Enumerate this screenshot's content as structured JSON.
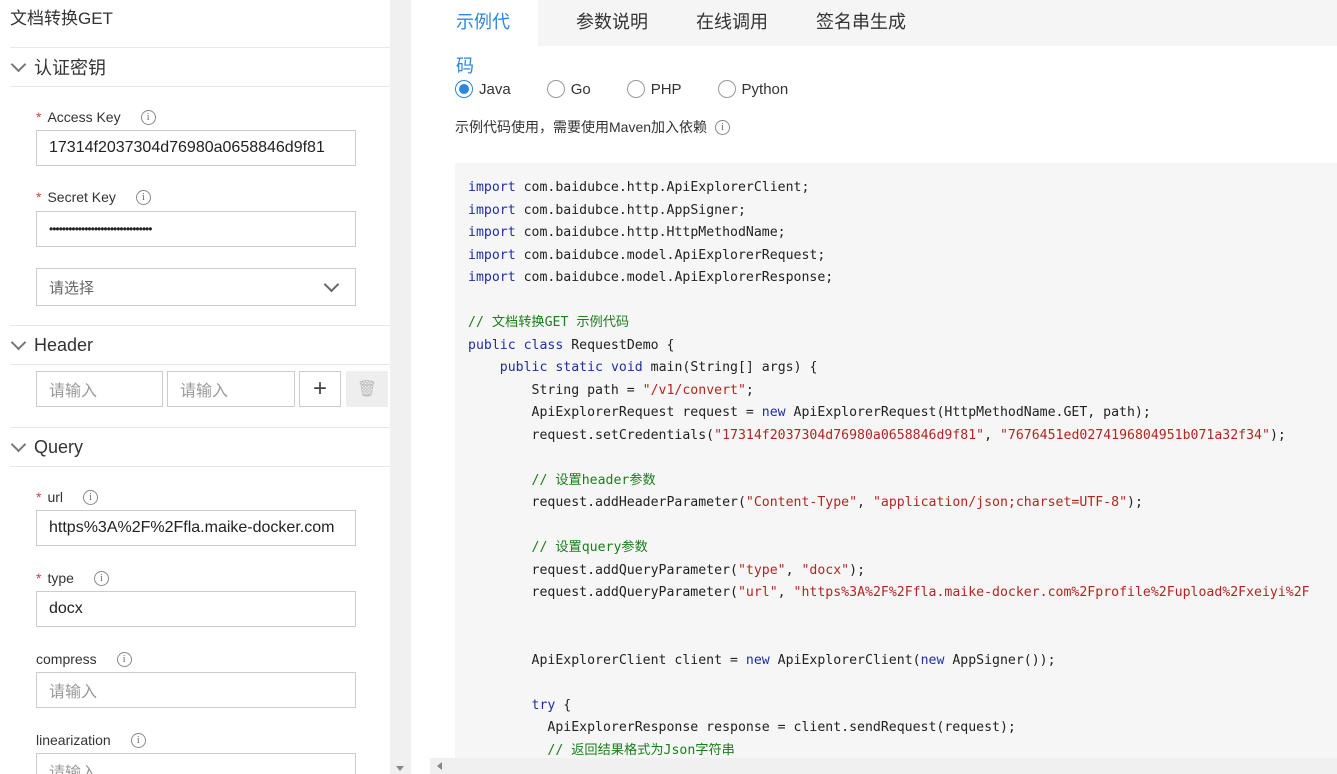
{
  "left": {
    "title": "文档转换GET",
    "auth_section": "认证密钥",
    "access_key_label": "Access Key",
    "access_key_value": "17314f2037304d76980a0658846d9f81",
    "secret_key_label": "Secret Key",
    "secret_key_value": "••••••••••••••••••••••••••••••••",
    "select_placeholder": "请选择",
    "header_section": "Header",
    "header_key_placeholder": "请输入",
    "header_value_placeholder": "请输入",
    "add_symbol": "+",
    "delete_symbol": "🗑",
    "query_section": "Query",
    "url_label": "url",
    "url_value": "https%3A%2F%2Ffla.maike-docker.com",
    "type_label": "type",
    "type_value": "docx",
    "compress_label": "compress",
    "compress_placeholder": "请输入",
    "linearization_label": "linearization",
    "linearization_placeholder": "请输入",
    "required_mark": "*",
    "info_glyph": "i"
  },
  "tabs": [
    "示例代码",
    "参数说明",
    "在线调用",
    "签名串生成"
  ],
  "languages": [
    {
      "label": "Java",
      "selected": true
    },
    {
      "label": "Go",
      "selected": false
    },
    {
      "label": "PHP",
      "selected": false
    },
    {
      "label": "Python",
      "selected": false
    }
  ],
  "hint": "示例代码使用，需要使用Maven加入依赖",
  "code": {
    "imports": [
      "com.baidubce.http.ApiExplorerClient;",
      "com.baidubce.http.AppSigner;",
      "com.baidubce.http.HttpMethodName;",
      "com.baidubce.model.ApiExplorerRequest;",
      "com.baidubce.model.ApiExplorerResponse;"
    ],
    "comment_title": "// 文档转换GET 示例代码",
    "path": "\"/v1/convert\"",
    "access_key": "\"17314f2037304d76980a0658846d9f81\"",
    "secret_key": "\"7676451ed0274196804951b071a32f34\"",
    "comment_header": "// 设置header参数",
    "header_name": "\"Content-Type\"",
    "header_value": "\"application/json;charset=UTF-8\"",
    "comment_query": "// 设置query参数",
    "q_type_name": "\"type\"",
    "q_type_value": "\"docx\"",
    "q_url_name": "\"url\"",
    "q_url_value": "\"https%3A%2F%2Ffla.maike-docker.com%2Fprofile%2Fupload%2Fxeiyi%2F",
    "comment_result": "// 返回结果格式为Json字符串"
  }
}
